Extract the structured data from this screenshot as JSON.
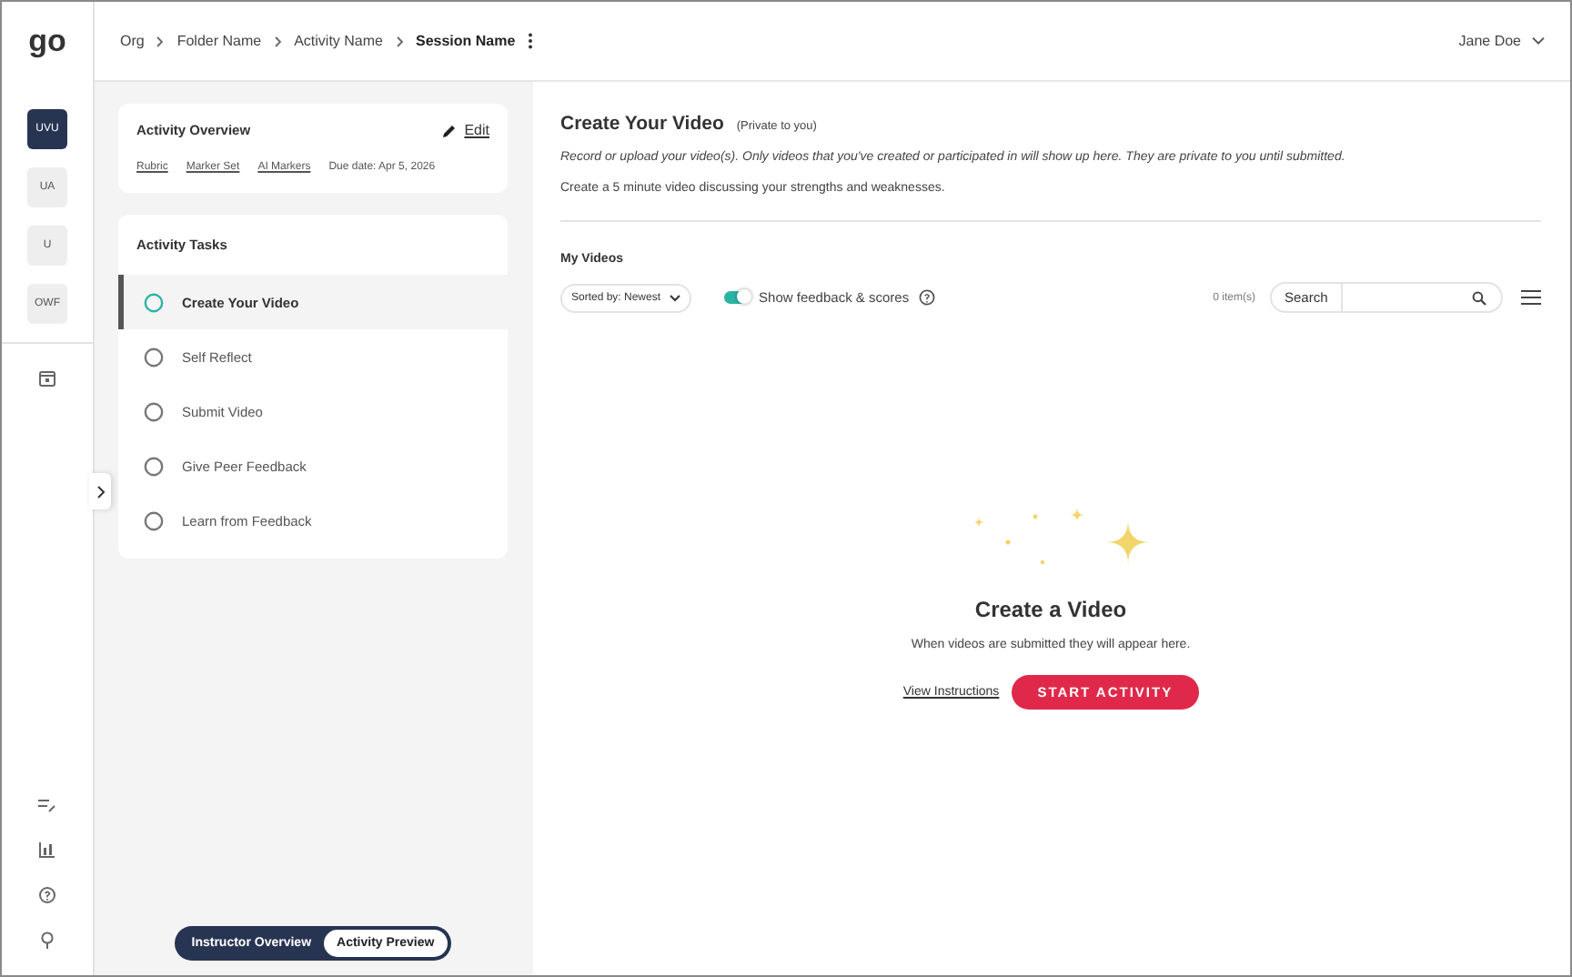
{
  "logo": "go",
  "breadcrumb": [
    {
      "label": "Org",
      "current": false
    },
    {
      "label": "Folder Name",
      "current": false
    },
    {
      "label": "Activity Name",
      "current": false
    },
    {
      "label": "Session Name",
      "current": true
    }
  ],
  "user": {
    "name": "Jane Doe"
  },
  "rail": {
    "items": [
      {
        "label": "UVU",
        "selected": true
      },
      {
        "label": "UA",
        "selected": false
      },
      {
        "label": "U",
        "selected": false
      },
      {
        "label": "OWF",
        "selected": false
      }
    ]
  },
  "overview": {
    "title": "Activity Overview",
    "edit": "Edit",
    "links": [
      "Rubric",
      "Marker Set",
      "AI Markers"
    ],
    "due": "Due date: Apr 5, 2026"
  },
  "tasks": {
    "title": "Activity Tasks",
    "items": [
      {
        "label": "Create Your Video",
        "selected": true
      },
      {
        "label": "Self Reflect",
        "selected": false
      },
      {
        "label": "Submit Video",
        "selected": false
      },
      {
        "label": "Give Peer Feedback",
        "selected": false
      },
      {
        "label": "Learn from Feedback",
        "selected": false
      }
    ]
  },
  "view_switch": [
    {
      "label": "Instructor Overview",
      "selected": false
    },
    {
      "label": "Activity Preview",
      "selected": true
    }
  ],
  "main": {
    "title": "Create Your Video",
    "badge": "(Private to you)",
    "description": "Record or upload your video(s). Only videos that you've created or participated in will show up here. They are private to you until submitted.",
    "prompt": "Create a 5 minute video discussing your strengths and weaknesses.",
    "section": "My Videos",
    "sort": "Sorted by: Newest",
    "toggle": {
      "label": "Show feedback & scores",
      "on": true
    },
    "count": "0 item(s)",
    "search_label": "Search",
    "empty": {
      "title": "Create a Video",
      "message": "When videos are submitted they will appear here.",
      "link": "View Instructions",
      "button": "START ACTIVITY"
    }
  }
}
